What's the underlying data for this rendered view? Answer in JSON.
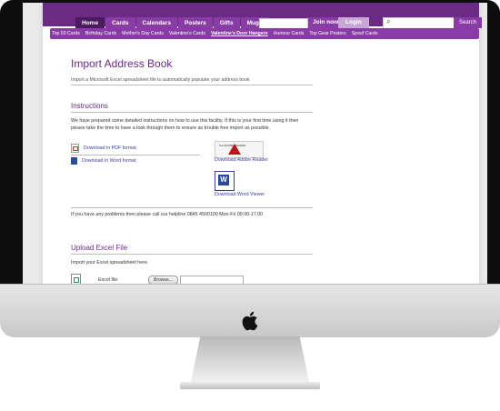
{
  "nav": {
    "tabs": [
      {
        "label": "Home"
      },
      {
        "label": "Cards"
      },
      {
        "label": "Calendars"
      },
      {
        "label": "Posters"
      },
      {
        "label": "Gifts"
      },
      {
        "label": "Mugs"
      }
    ],
    "join_label": "Join now",
    "login_label": "Login",
    "search_button": "Search"
  },
  "subnav": {
    "items": [
      {
        "label": "Top 50 Cards"
      },
      {
        "label": "Birthday Cards"
      },
      {
        "label": "Mother's Day Cards"
      },
      {
        "label": "Valentine's Cards"
      },
      {
        "label": "Valentine's Door Hangers"
      },
      {
        "label": "Humour Cards"
      },
      {
        "label": "Top Gear Posters"
      },
      {
        "label": "Spoof Cards"
      }
    ]
  },
  "main": {
    "title": "Import Address Book",
    "intro": "Import a Microsoft Excel spreadsheet file to automatically populate your address book",
    "instructions_heading": "Instructions",
    "instructions_text": "We have prepared some detailed instructions on how to use this facility. If this is your first time using it then please take the time to have a look through them to ensure as trouble free import as possible.",
    "download_pdf": "Download in PDF format",
    "download_word": "Download in Word format",
    "adobe_badge": "Get ADOBE READER",
    "download_adobe": "Download Adobe Reader",
    "download_word_viewer": "Download Word Viewer",
    "helpline": "If you have any problems then please call our helpline 0845 4500100 Mon-Fri 09.00-17.00",
    "upload_heading": "Upload Excel File",
    "upload_text": "Import your Excel spreadsheet here.",
    "excel_label": "Excel file:",
    "browse_label": "Browse..."
  },
  "colors": {
    "brand_purple": "#6b2a83",
    "nav_purple": "#8a3ca6",
    "link_blue": "#3b3b9e"
  }
}
